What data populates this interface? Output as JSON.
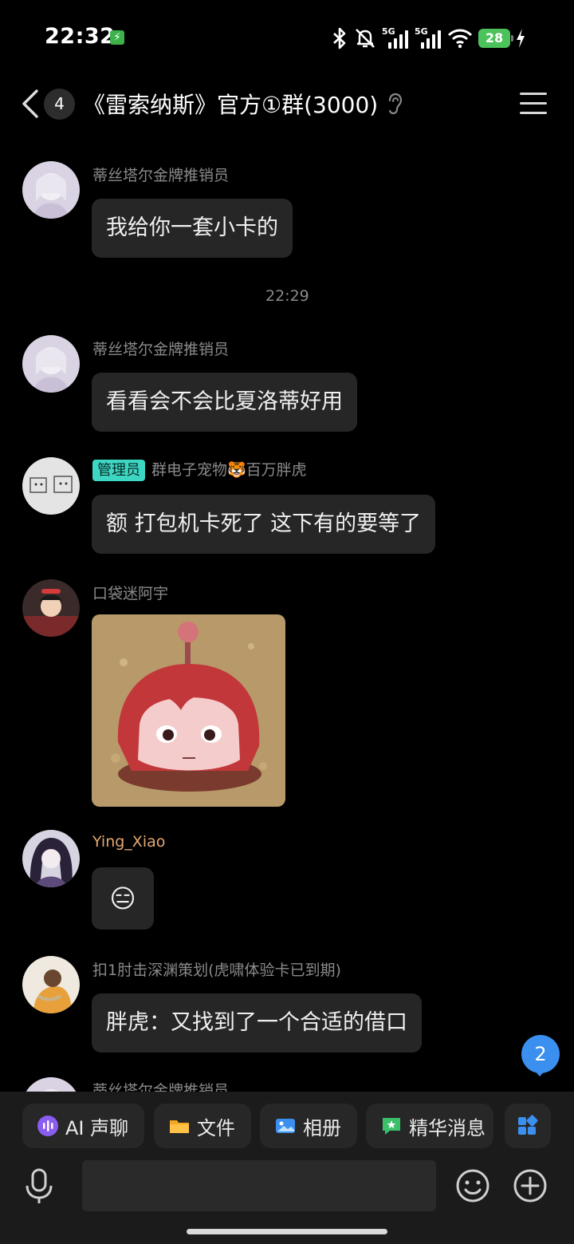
{
  "status_bar": {
    "time": "22:32",
    "net_5g_a": "5G",
    "net_5g_b": "5G",
    "battery": "28"
  },
  "header": {
    "unread_count": "4",
    "group_title": "《雷索纳斯》官方①群(3000)"
  },
  "messages": [
    {
      "sender": "蒂丝塔尔金牌推销员",
      "text": "我给你一套小卡的"
    },
    {
      "timestamp": "22:29"
    },
    {
      "sender": "蒂丝塔尔金牌推销员",
      "text": "看看会不会比夏洛蒂好用"
    },
    {
      "role": "管理员",
      "sender": "群电子宠物🐯百万胖虎",
      "text": "额 打包机卡死了 这下有的要等了"
    },
    {
      "sender": "口袋迷阿宇",
      "type": "image"
    },
    {
      "sender": "Ying_Xiao",
      "sender_color": "#e4a873",
      "emoji": "😑"
    },
    {
      "sender": "扣1肘击深渊策划(虎啸体验卡已到期)",
      "text": "胖虎：又找到了一个合适的借口"
    },
    {
      "sender": "蒂丝塔尔金牌推销员"
    }
  ],
  "new_message_count": "2",
  "toolbar": {
    "ai_voice": "AI 声聊",
    "file": "文件",
    "album": "相册",
    "essence": "精华消息"
  },
  "input": {
    "placeholder": ""
  },
  "colors": {
    "background": "#000000",
    "bubble": "#262626",
    "admin_badge": "#3dd6c2",
    "new_msg_badge": "#3b8fef"
  }
}
